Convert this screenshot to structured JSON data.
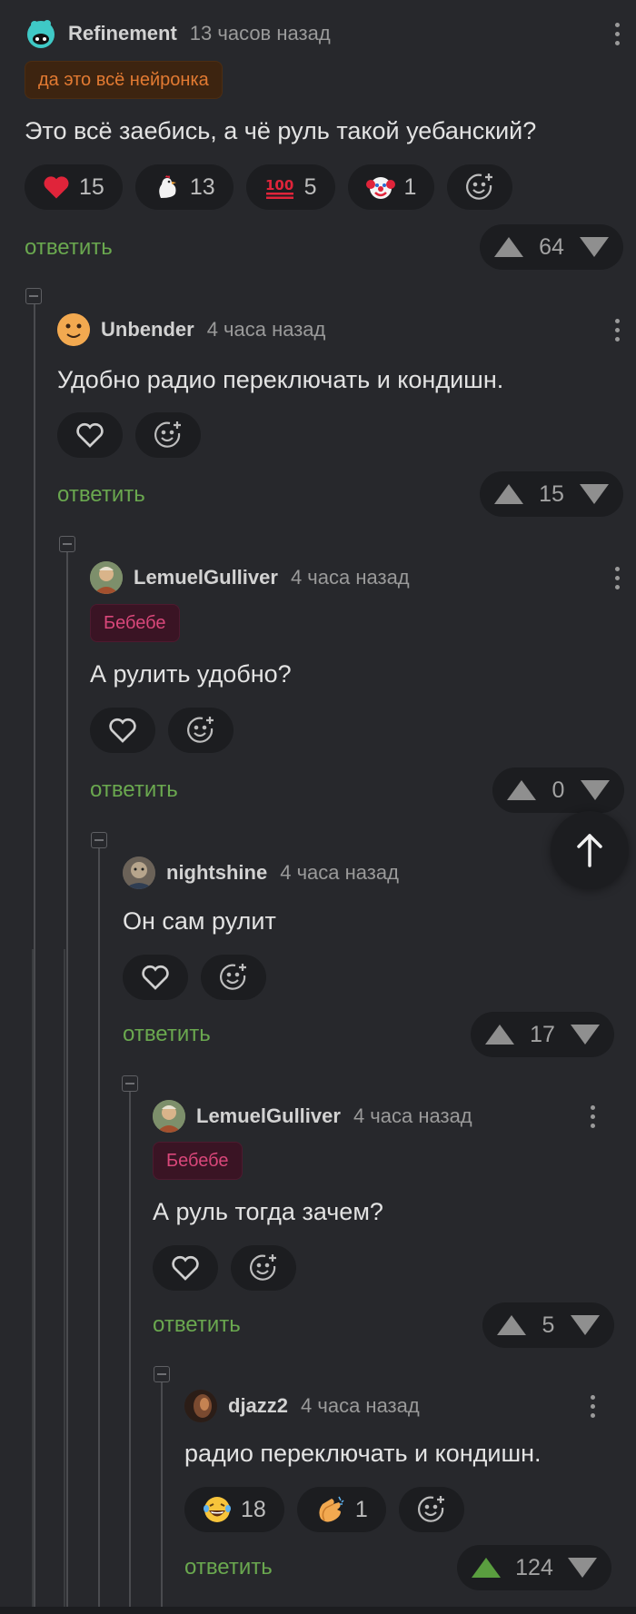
{
  "comments": [
    {
      "username": "Refinement",
      "time": "13 часов назад",
      "tag": "да это всё нейронка",
      "text": "Это всё заебись, а чё руль такой уебанский?",
      "reactions": [
        {
          "icon": "heart-icon",
          "count": "15"
        },
        {
          "icon": "chicken-icon",
          "count": "13"
        },
        {
          "icon": "hundred-icon",
          "count": "5"
        },
        {
          "icon": "clown-icon",
          "count": "1"
        }
      ],
      "reply_label": "ответить",
      "score": "64"
    },
    {
      "username": "Unbender",
      "time": "4 часа назад",
      "text": "Удобно радио переключать и кондишн.",
      "reply_label": "ответить",
      "score": "15"
    },
    {
      "username": "LemuelGulliver",
      "time": "4 часа назад",
      "tag": "Бебебе",
      "text": "А рулить удобно?",
      "reply_label": "ответить",
      "score": "0"
    },
    {
      "username": "nightshine",
      "time": "4 часа назад",
      "text": "Он сам рулит",
      "reply_label": "ответить",
      "score": "17"
    },
    {
      "username": "LemuelGulliver",
      "time": "4 часа назад",
      "tag": "Бебебе",
      "text": "А руль тогда зачем?",
      "reply_label": "ответить",
      "score": "5"
    },
    {
      "username": "djazz2",
      "time": "4 часа назад",
      "text": "радио переключать и кондишн.",
      "reactions": [
        {
          "icon": "laughing-tears-icon",
          "count": "18"
        },
        {
          "icon": "clapping-hands-icon",
          "count": "1"
        }
      ],
      "reply_label": "ответить",
      "score": "124"
    }
  ],
  "colors": {
    "background": "#27282c",
    "reply_link": "#6aa84f",
    "tag_orange": "#e27a32",
    "tag_pink": "#d9477a",
    "upvote_active": "#5a9e3f"
  },
  "icons": {
    "add_reaction": "smiley-plus-icon",
    "like": "heart-outline-icon",
    "more": "kebab-menu-icon",
    "collapse": "collapse-minus-icon",
    "scroll_top": "arrow-up-icon"
  }
}
